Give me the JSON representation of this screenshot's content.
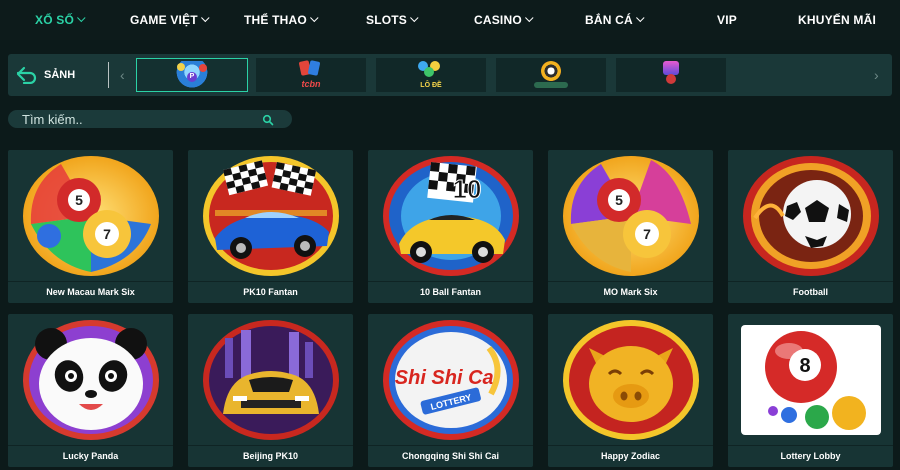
{
  "nav": {
    "items": [
      {
        "label": "XỔ SỐ",
        "dropdown": true,
        "active": true
      },
      {
        "label": "GAME VIỆT",
        "dropdown": true
      },
      {
        "label": "THỂ THAO",
        "dropdown": true
      },
      {
        "label": "SLOTS",
        "dropdown": true
      },
      {
        "label": "CASINO",
        "dropdown": true
      },
      {
        "label": "BẮN CÁ",
        "dropdown": true
      },
      {
        "label": "VIP",
        "dropdown": false
      },
      {
        "label": "KHUYẾN MÃI",
        "dropdown": false
      }
    ]
  },
  "strip": {
    "back_label": "SẢNH",
    "providers": [
      {
        "icon": "lottery-provider-logo",
        "selected": true
      },
      {
        "icon": "tcbn-provider-logo",
        "selected": false,
        "text": "tcbn"
      },
      {
        "icon": "lo-de-provider-logo",
        "selected": false,
        "text": "LÔ ĐỀ"
      },
      {
        "icon": "gpi-play-provider-logo",
        "selected": false
      },
      {
        "icon": "gaming-provider-logo",
        "selected": false
      }
    ]
  },
  "search": {
    "placeholder": "Tìm kiếm.."
  },
  "games": [
    {
      "name": "New Macau Mark Six",
      "icon": "lottery-balls-icon"
    },
    {
      "name": "PK10 Fantan",
      "icon": "race-car-flags-icon"
    },
    {
      "name": "10 Ball Fantan",
      "icon": "ten-ball-car-icon"
    },
    {
      "name": "MO Mark Six",
      "icon": "lottery-balls-icon"
    },
    {
      "name": "Football",
      "icon": "football-icon"
    },
    {
      "name": "Lucky Panda",
      "icon": "panda-icon"
    },
    {
      "name": "Beijing PK10",
      "icon": "sports-car-icon"
    },
    {
      "name": "Chongqing Shi Shi Cai",
      "icon": "shi-shi-cai-logo"
    },
    {
      "name": "Happy Zodiac",
      "icon": "golden-pig-icon"
    },
    {
      "name": "Lottery Lobby",
      "icon": "lottery-ball-8-icon"
    }
  ],
  "thumb_texts": {
    "shishicai": "Shi Shi Cai",
    "lottery": "LOTTERY",
    "ten": "10"
  },
  "colors": {
    "accent": "#2bd2a6",
    "card": "#173434",
    "background": "#0c1a1a"
  }
}
